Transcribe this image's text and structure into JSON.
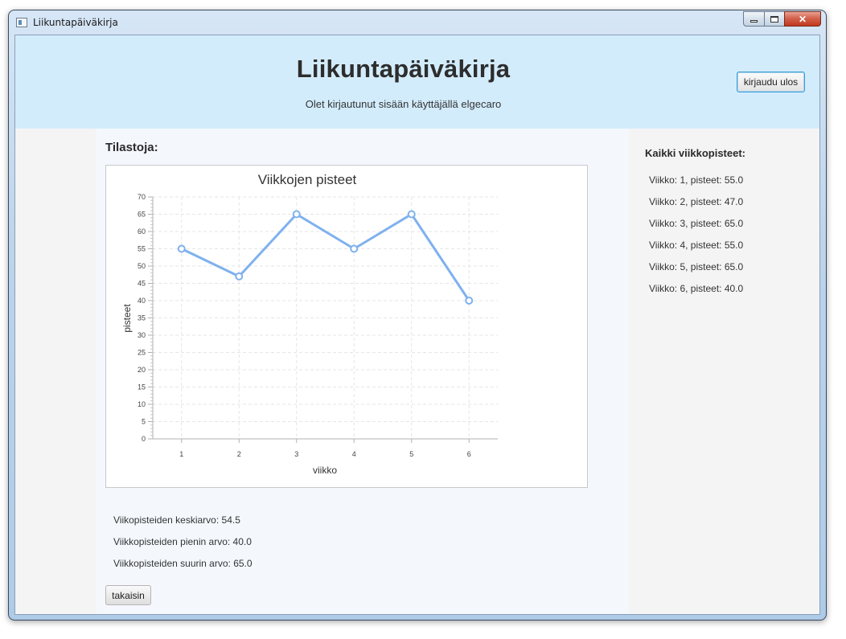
{
  "window": {
    "title": "Liikuntapäiväkirja",
    "controls": {
      "minimize": "minimize-icon",
      "maximize": "maximize-icon",
      "close": "✕"
    }
  },
  "header": {
    "title": "Liikuntapäiväkirja",
    "status": "Olet kirjautunut sisään käyttäjällä elgecaro",
    "logout_label": "kirjaudu ulos"
  },
  "main": {
    "heading": "Tilastoja:",
    "average": "Viikopisteiden keskiarvo: 54.5",
    "minimum": "Viikkopisteiden pienin arvo: 40.0",
    "maximum": "Viikkopisteiden suurin arvo: 65.0",
    "back_label": "takaisin"
  },
  "sidebar": {
    "heading": "Kaikki viikkopisteet:",
    "weeks": [
      "Viikko: 1, pisteet: 55.0",
      "Viikko: 2, pisteet: 47.0",
      "Viikko: 3, pisteet: 65.0",
      "Viikko: 4, pisteet: 55.0",
      "Viikko: 5, pisteet: 65.0",
      "Viikko: 6, pisteet: 40.0"
    ]
  },
  "colors": {
    "header_bg": "#d3ecfc",
    "series": "#7fb1ee",
    "logout_border": "#3d9cd6"
  },
  "chart_data": {
    "type": "line",
    "title": "Viikkojen pisteet",
    "xlabel": "viikko",
    "ylabel": "pisteet",
    "categories": [
      "1",
      "2",
      "3",
      "4",
      "5",
      "6"
    ],
    "values": [
      55,
      47,
      65,
      55,
      65,
      40
    ],
    "ylim": [
      0,
      70
    ],
    "yticks": [
      0,
      5,
      10,
      15,
      20,
      25,
      30,
      35,
      40,
      45,
      50,
      55,
      60,
      65,
      70
    ],
    "grid": true,
    "legend": "none"
  }
}
